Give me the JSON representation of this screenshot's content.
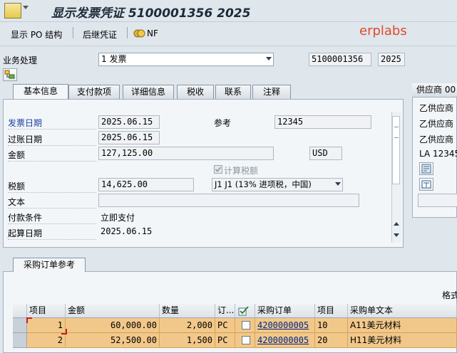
{
  "window": {
    "title": "显示发票凭证 5100001356 2025"
  },
  "toolbar": {
    "po_structure": "显示 PO 结构",
    "follow_docs": "后继凭证",
    "nf": "NF"
  },
  "watermark": "erplabs",
  "header": {
    "transaction_label": "业务处理",
    "transaction_value": "1 发票",
    "doc_number": "5100001356",
    "fiscal_year": "2025"
  },
  "tabs": [
    {
      "label": "基本信息"
    },
    {
      "label": "支付款项"
    },
    {
      "label": "详细信息"
    },
    {
      "label": "税收"
    },
    {
      "label": "联系"
    },
    {
      "label": "注释"
    }
  ],
  "basic": {
    "invoice_date_label": "发票日期",
    "invoice_date": "2025.06.15",
    "reference_label": "参考",
    "reference": "12345",
    "posting_date_label": "过账日期",
    "posting_date": "2025.06.15",
    "amount_label": "金额",
    "amount": "127,125.00",
    "currency": "USD",
    "calc_tax_label": "计算税额",
    "tax_label": "税额",
    "tax_amount": "14,625.00",
    "tax_code": "J1 J1 (13% 进项税，中国)",
    "text_label": "文本",
    "text_value": "",
    "payment_terms_label": "付款条件",
    "payment_terms": "立即支付",
    "baseline_label": "起算日期",
    "baseline_date": "2025.06.15"
  },
  "vendor": {
    "title": "供应商 00",
    "lines": [
      "乙供应商",
      "乙供应商",
      "乙供应商",
      "LA 12345"
    ]
  },
  "po_section": {
    "tab": "采购订单参考",
    "layout_label": "格式",
    "columns": [
      "项目",
      "金额",
      "数量",
      "订...",
      "",
      "采购订单",
      "项目",
      "采购单文本"
    ],
    "rows": [
      {
        "item": "1",
        "amount": "60,000.00",
        "qty": "2,000",
        "unit": "PC",
        "po": "4200000005",
        "po_item": "10",
        "text": "A11美元材料"
      },
      {
        "item": "2",
        "amount": "52,500.00",
        "qty": "1,500",
        "unit": "PC",
        "po": "4200000005",
        "po_item": "20",
        "text": "H11美元材料"
      }
    ]
  }
}
